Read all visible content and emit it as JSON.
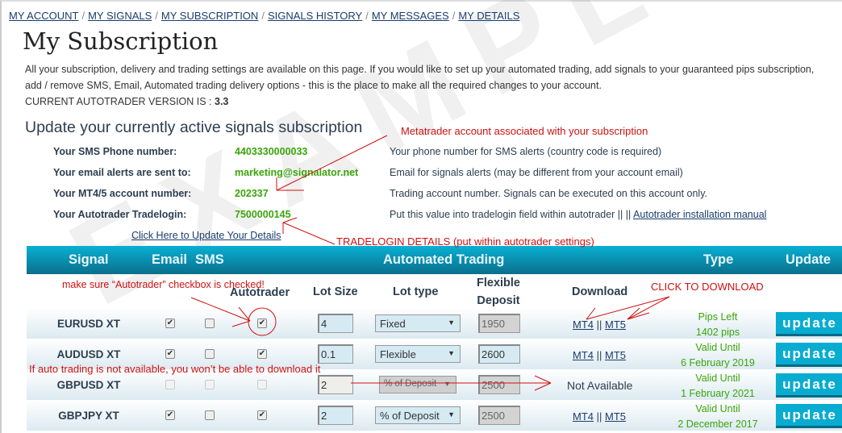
{
  "breadcrumb": [
    "MY ACCOUNT",
    "MY SIGNALS",
    "MY SUBSCRIPTION",
    "SIGNALS HISTORY",
    "MY MESSAGES",
    "MY DETAILS"
  ],
  "page_title": "My Subscription",
  "intro": {
    "line1": "All your subscription, delivery and trading settings are available on this page. If you would like to set up your automated trading, add signals to your guaranteed pips subscription,",
    "line2": "add / remove SMS, Email, Automated trading delivery options - this is the place to make all the required changes to your account.",
    "version_label": "CURRENT AUTOTRADER VERSION IS : ",
    "version": "3.3"
  },
  "section_title": "Update your currently active signals subscription",
  "details": [
    {
      "label": "Your SMS Phone number:",
      "value": "4403330000033",
      "desc": "Your phone number for SMS alerts (country code is required)"
    },
    {
      "label": "Your email alerts are sent to:",
      "value": "marketing@signalator.net",
      "desc": "Email for signals alerts (may be different from your account email)"
    },
    {
      "label": "Your MT4/5 account number:",
      "value": "202337",
      "desc": "Trading account number. Signals can be executed on this account only."
    },
    {
      "label": "Your Autotrader Tradelogin:",
      "value": "7500000145",
      "desc": "Put this value into tradelogin field within autotrader || || ",
      "link": "Autotrader installation manual"
    }
  ],
  "update_details_link": "Click Here to Update Your Details",
  "table": {
    "headers": {
      "signal": "Signal",
      "email": "Email",
      "sms": "SMS",
      "automated": "Automated Trading",
      "type": "Type",
      "update": "Update"
    },
    "subheaders": {
      "autotrader": "Autotrader",
      "lot_size": "Lot Size",
      "lot_type": "Lot type",
      "flex1": "Flexible",
      "flex2": "Deposit",
      "download": "Download"
    },
    "rows": [
      {
        "signal": "EURUSD XT",
        "email": true,
        "sms": false,
        "autotrader": true,
        "disabled": false,
        "lot_size": "4",
        "lot_type": "Fixed",
        "deposit": "1950",
        "deposit_editable": false,
        "mt4": "MT4",
        "sep": "||",
        "mt5": "MT5",
        "type1": "Pips Left",
        "type2": "1402 pips",
        "button": "update"
      },
      {
        "signal": "AUDUSD XT",
        "email": true,
        "sms": false,
        "autotrader": true,
        "disabled": false,
        "lot_size": "0.1",
        "lot_type": "Flexible",
        "deposit": "2600",
        "deposit_editable": true,
        "mt4": "MT4",
        "sep": "||",
        "mt5": "MT5",
        "type1": "Valid Until",
        "type2": "6 February 2019",
        "button": "update"
      },
      {
        "signal": "GBPUSD XT",
        "email": false,
        "sms": false,
        "autotrader": false,
        "disabled": true,
        "lot_size": "2",
        "lot_type": "% of Deposit",
        "deposit": "2500",
        "deposit_editable": false,
        "download_text": "Not Available",
        "type1": "Valid Until",
        "type2": "1 February 2021",
        "button": "update"
      },
      {
        "signal": "GBPJPY XT",
        "email": true,
        "sms": false,
        "autotrader": true,
        "disabled": false,
        "lot_size": "2",
        "lot_type": "% of Deposit",
        "deposit": "2500",
        "deposit_editable": false,
        "mt4": "MT4",
        "sep": "||",
        "mt5": "MT5",
        "type1": "Valid Until",
        "type2": "2 December 2017",
        "button": "update"
      }
    ]
  },
  "annotations": {
    "metatrader": "Metatrader account associated with your subscription",
    "tradelogin": "TRADELOGIN DETAILS (put within autotrader settings)",
    "autotrader_check": "make sure “Autotrader” checkbox is checked!",
    "click_download": "CLICK TO DOWNLOAD",
    "not_available": "If auto trading is not available, you won’t be able to download it"
  },
  "watermark": "EXAMPLE",
  "colors": {
    "header_bar": "#08b0d3",
    "value_green": "#3aa50b",
    "annotation_red": "#d01010",
    "button": "#08acd0"
  }
}
